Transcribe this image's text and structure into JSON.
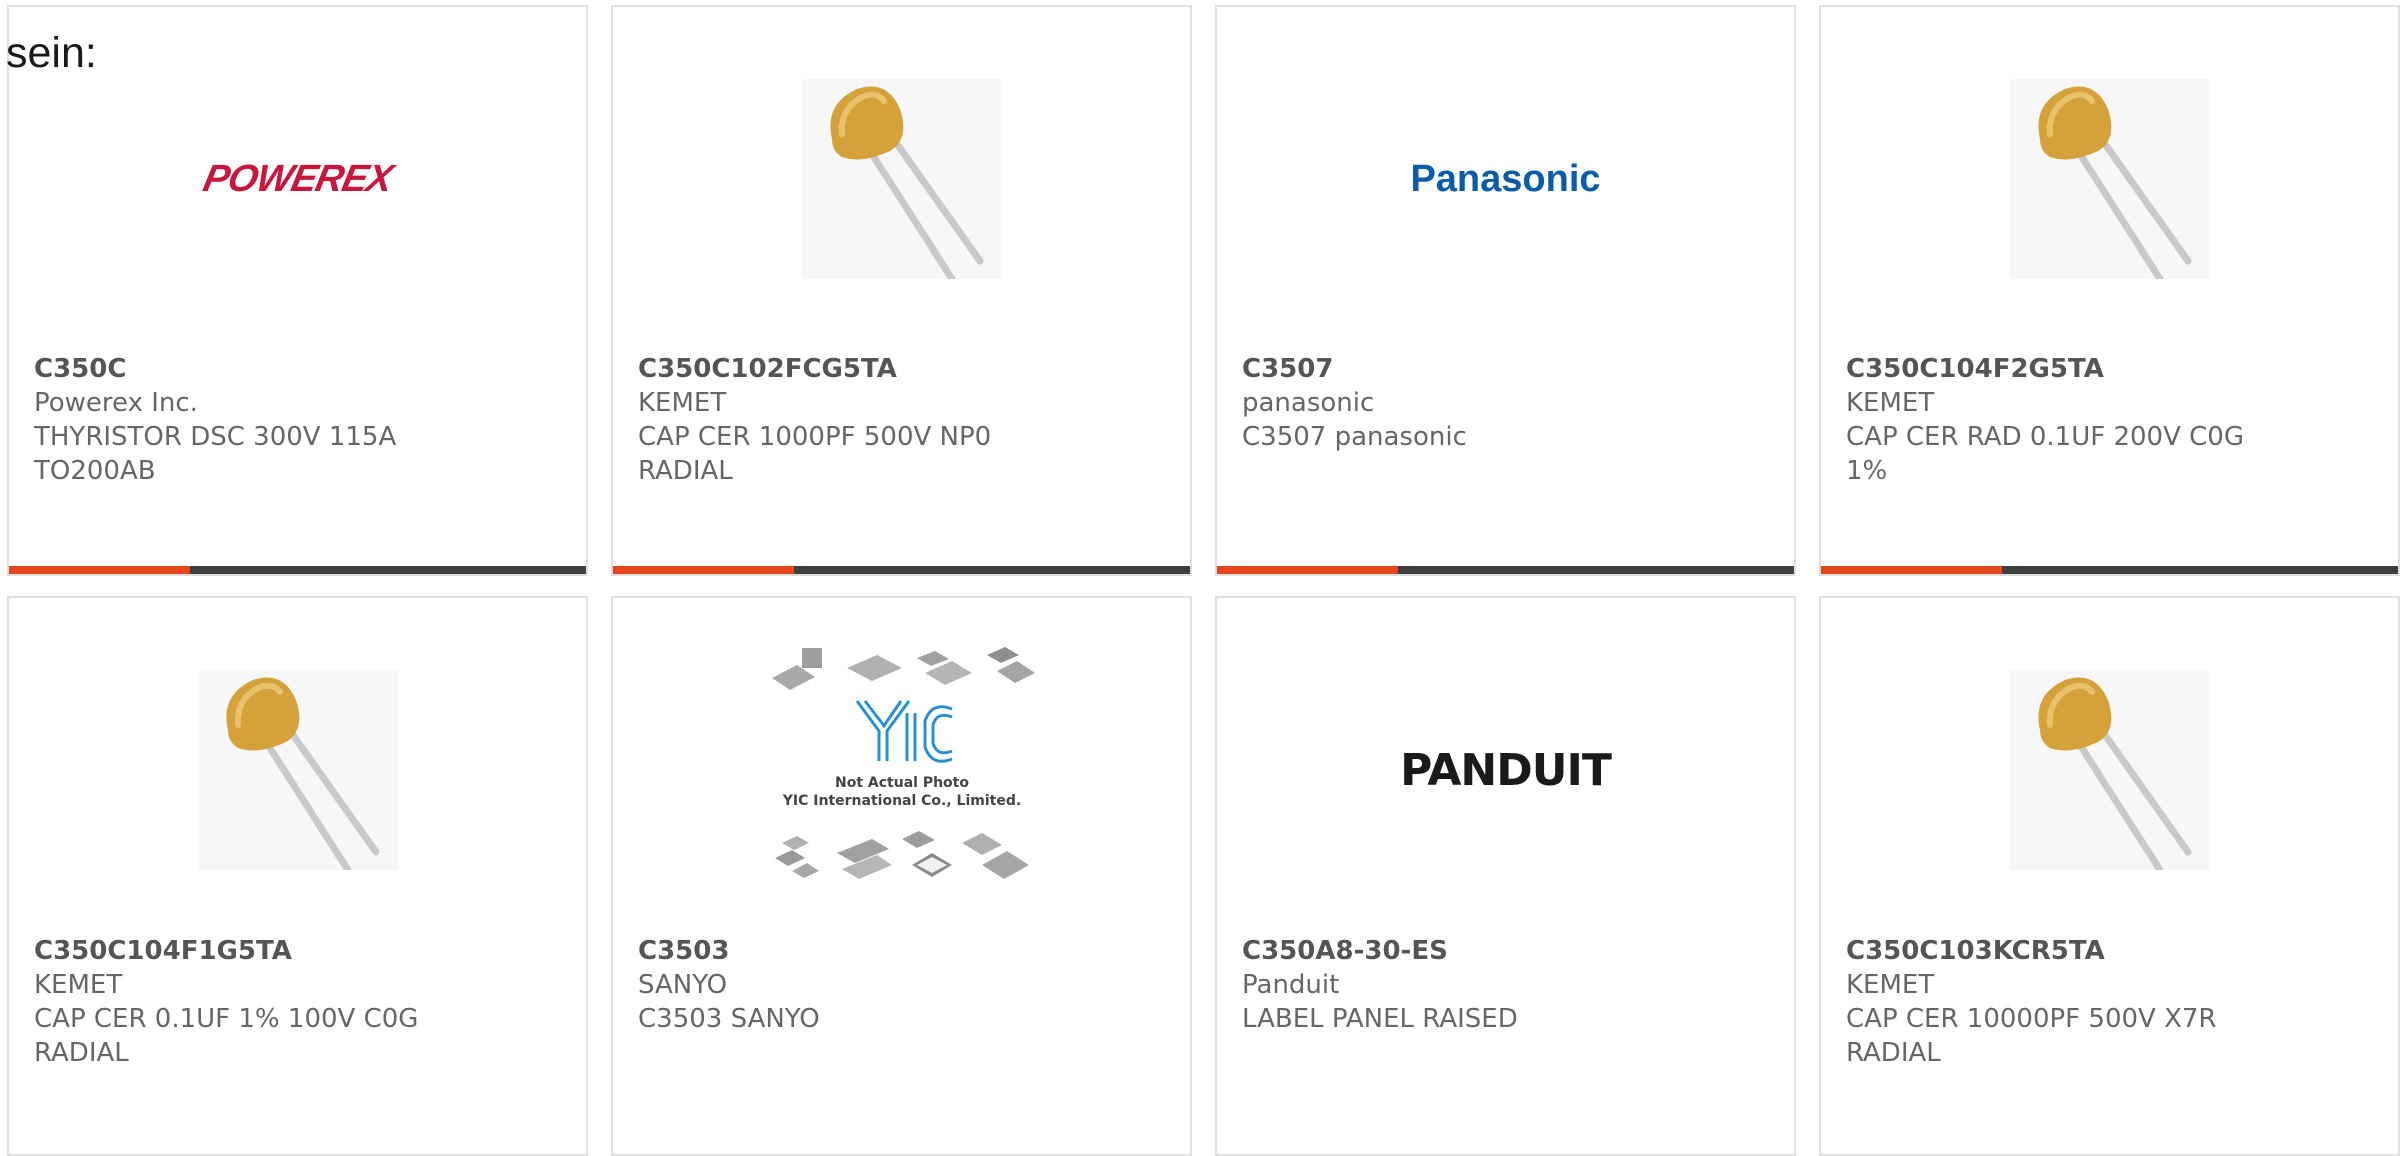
{
  "intro_text": "sein:",
  "colors": {
    "accent": "#e8441c",
    "bar": "#404040",
    "border": "#e0e0e0",
    "powerex_red": "#c8163c",
    "panasonic_blue": "#0a5ca8"
  },
  "products": [
    {
      "part_number": "C350C",
      "manufacturer": "Powerex Inc.",
      "description": "THYRISTOR DSC 300V 115A TO200AB",
      "image": "powerex-logo",
      "logo_text": "POWEREX"
    },
    {
      "part_number": "C350C102FCG5TA",
      "manufacturer": "KEMET",
      "description": "CAP CER 1000PF 500V NP0 RADIAL",
      "image": "radial-capacitor-photo"
    },
    {
      "part_number": "C3507",
      "manufacturer": "panasonic",
      "description": "C3507 panasonic",
      "image": "panasonic-logo",
      "logo_text": "Panasonic"
    },
    {
      "part_number": "C350C104F2G5TA",
      "manufacturer": "KEMET",
      "description": "CAP CER RAD 0.1UF 200V C0G 1%",
      "image": "radial-capacitor-photo"
    },
    {
      "part_number": "C350C104F1G5TA",
      "manufacturer": "KEMET",
      "description": "CAP CER 0.1UF 1% 100V C0G RADIAL",
      "image": "radial-capacitor-photo"
    },
    {
      "part_number": "C3503",
      "manufacturer": "SANYO",
      "description": "C3503 SANYO",
      "image": "yic-placeholder",
      "placeholder_line1": "Not Actual Photo",
      "placeholder_line2": "YIC International Co., Limited."
    },
    {
      "part_number": "C350A8-30-ES",
      "manufacturer": "Panduit",
      "description": "LABEL PANEL RAISED",
      "image": "panduit-logo",
      "logo_text": "PANDUIT"
    },
    {
      "part_number": "C350C103KCR5TA",
      "manufacturer": "KEMET",
      "description": "CAP CER 10000PF 500V X7R RADIAL",
      "image": "radial-capacitor-photo"
    }
  ]
}
